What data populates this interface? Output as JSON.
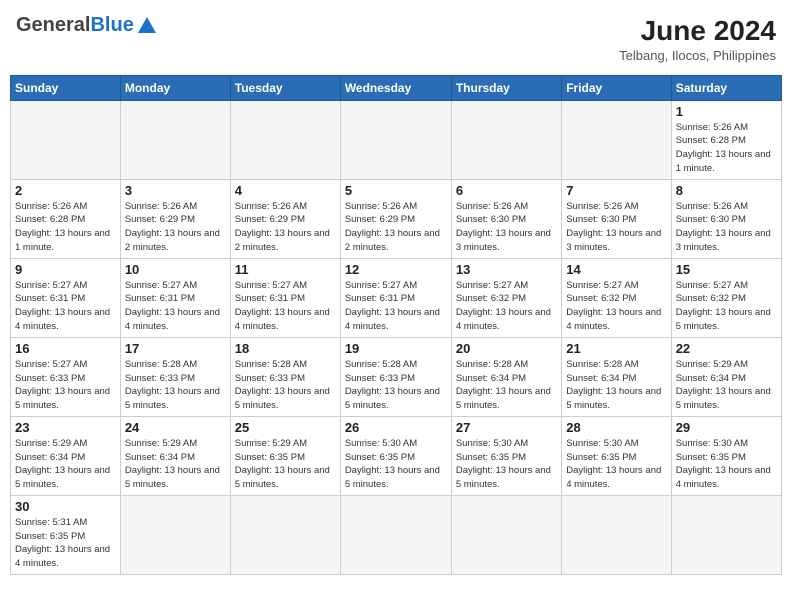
{
  "header": {
    "title": "June 2024",
    "location": "Telbang, Ilocos, Philippines",
    "logo_general": "General",
    "logo_blue": "Blue"
  },
  "days_of_week": [
    "Sunday",
    "Monday",
    "Tuesday",
    "Wednesday",
    "Thursday",
    "Friday",
    "Saturday"
  ],
  "weeks": [
    [
      {
        "day": "",
        "info": ""
      },
      {
        "day": "",
        "info": ""
      },
      {
        "day": "",
        "info": ""
      },
      {
        "day": "",
        "info": ""
      },
      {
        "day": "",
        "info": ""
      },
      {
        "day": "",
        "info": ""
      },
      {
        "day": "1",
        "info": "Sunrise: 5:26 AM\nSunset: 6:28 PM\nDaylight: 13 hours and 1 minute."
      }
    ],
    [
      {
        "day": "2",
        "info": "Sunrise: 5:26 AM\nSunset: 6:28 PM\nDaylight: 13 hours and 1 minute."
      },
      {
        "day": "3",
        "info": "Sunrise: 5:26 AM\nSunset: 6:29 PM\nDaylight: 13 hours and 2 minutes."
      },
      {
        "day": "4",
        "info": "Sunrise: 5:26 AM\nSunset: 6:29 PM\nDaylight: 13 hours and 2 minutes."
      },
      {
        "day": "5",
        "info": "Sunrise: 5:26 AM\nSunset: 6:29 PM\nDaylight: 13 hours and 2 minutes."
      },
      {
        "day": "6",
        "info": "Sunrise: 5:26 AM\nSunset: 6:30 PM\nDaylight: 13 hours and 3 minutes."
      },
      {
        "day": "7",
        "info": "Sunrise: 5:26 AM\nSunset: 6:30 PM\nDaylight: 13 hours and 3 minutes."
      },
      {
        "day": "8",
        "info": "Sunrise: 5:26 AM\nSunset: 6:30 PM\nDaylight: 13 hours and 3 minutes."
      }
    ],
    [
      {
        "day": "9",
        "info": "Sunrise: 5:27 AM\nSunset: 6:31 PM\nDaylight: 13 hours and 4 minutes."
      },
      {
        "day": "10",
        "info": "Sunrise: 5:27 AM\nSunset: 6:31 PM\nDaylight: 13 hours and 4 minutes."
      },
      {
        "day": "11",
        "info": "Sunrise: 5:27 AM\nSunset: 6:31 PM\nDaylight: 13 hours and 4 minutes."
      },
      {
        "day": "12",
        "info": "Sunrise: 5:27 AM\nSunset: 6:31 PM\nDaylight: 13 hours and 4 minutes."
      },
      {
        "day": "13",
        "info": "Sunrise: 5:27 AM\nSunset: 6:32 PM\nDaylight: 13 hours and 4 minutes."
      },
      {
        "day": "14",
        "info": "Sunrise: 5:27 AM\nSunset: 6:32 PM\nDaylight: 13 hours and 4 minutes."
      },
      {
        "day": "15",
        "info": "Sunrise: 5:27 AM\nSunset: 6:32 PM\nDaylight: 13 hours and 5 minutes."
      }
    ],
    [
      {
        "day": "16",
        "info": "Sunrise: 5:27 AM\nSunset: 6:33 PM\nDaylight: 13 hours and 5 minutes."
      },
      {
        "day": "17",
        "info": "Sunrise: 5:28 AM\nSunset: 6:33 PM\nDaylight: 13 hours and 5 minutes."
      },
      {
        "day": "18",
        "info": "Sunrise: 5:28 AM\nSunset: 6:33 PM\nDaylight: 13 hours and 5 minutes."
      },
      {
        "day": "19",
        "info": "Sunrise: 5:28 AM\nSunset: 6:33 PM\nDaylight: 13 hours and 5 minutes."
      },
      {
        "day": "20",
        "info": "Sunrise: 5:28 AM\nSunset: 6:34 PM\nDaylight: 13 hours and 5 minutes."
      },
      {
        "day": "21",
        "info": "Sunrise: 5:28 AM\nSunset: 6:34 PM\nDaylight: 13 hours and 5 minutes."
      },
      {
        "day": "22",
        "info": "Sunrise: 5:29 AM\nSunset: 6:34 PM\nDaylight: 13 hours and 5 minutes."
      }
    ],
    [
      {
        "day": "23",
        "info": "Sunrise: 5:29 AM\nSunset: 6:34 PM\nDaylight: 13 hours and 5 minutes."
      },
      {
        "day": "24",
        "info": "Sunrise: 5:29 AM\nSunset: 6:34 PM\nDaylight: 13 hours and 5 minutes."
      },
      {
        "day": "25",
        "info": "Sunrise: 5:29 AM\nSunset: 6:35 PM\nDaylight: 13 hours and 5 minutes."
      },
      {
        "day": "26",
        "info": "Sunrise: 5:30 AM\nSunset: 6:35 PM\nDaylight: 13 hours and 5 minutes."
      },
      {
        "day": "27",
        "info": "Sunrise: 5:30 AM\nSunset: 6:35 PM\nDaylight: 13 hours and 5 minutes."
      },
      {
        "day": "28",
        "info": "Sunrise: 5:30 AM\nSunset: 6:35 PM\nDaylight: 13 hours and 4 minutes."
      },
      {
        "day": "29",
        "info": "Sunrise: 5:30 AM\nSunset: 6:35 PM\nDaylight: 13 hours and 4 minutes."
      }
    ],
    [
      {
        "day": "30",
        "info": "Sunrise: 5:31 AM\nSunset: 6:35 PM\nDaylight: 13 hours and 4 minutes."
      },
      {
        "day": "",
        "info": ""
      },
      {
        "day": "",
        "info": ""
      },
      {
        "day": "",
        "info": ""
      },
      {
        "day": "",
        "info": ""
      },
      {
        "day": "",
        "info": ""
      },
      {
        "day": "",
        "info": ""
      }
    ]
  ]
}
